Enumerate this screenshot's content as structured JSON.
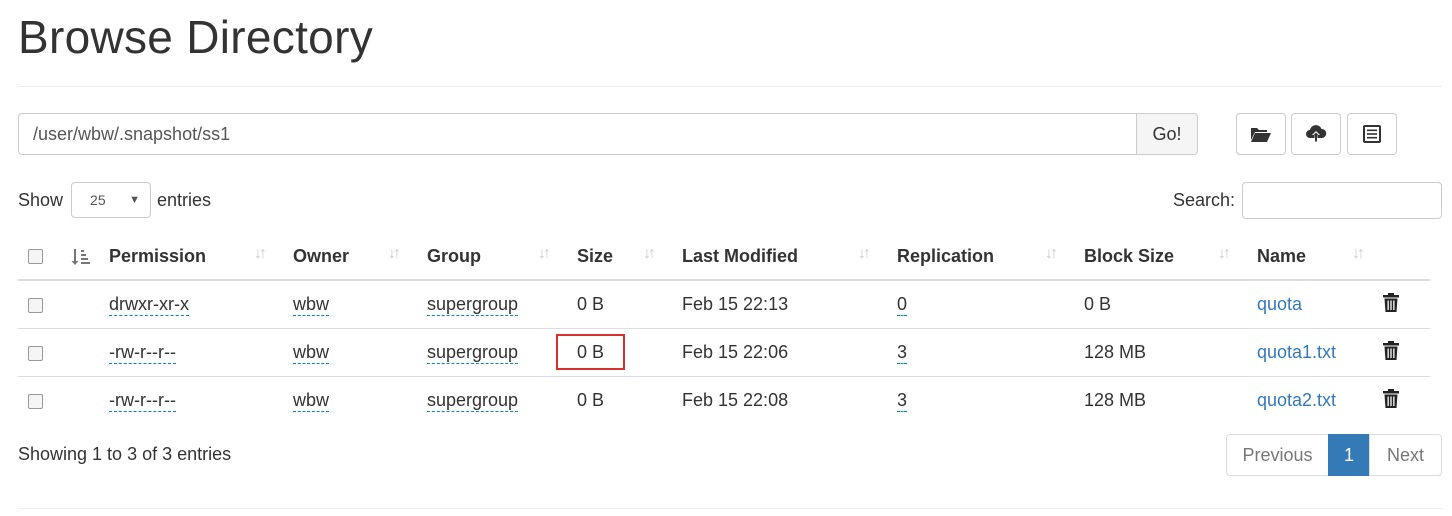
{
  "header": {
    "title": "Browse Directory"
  },
  "path_bar": {
    "value": "/user/wbw/.snapshot/ss1",
    "go_label": "Go!"
  },
  "toolbar_icons": [
    "open-folder-icon",
    "cloud-upload-icon",
    "list-icon"
  ],
  "length_control": {
    "show_label": "Show",
    "selected": "25",
    "entries_label": "entries"
  },
  "search": {
    "label": "Search:",
    "value": ""
  },
  "table": {
    "columns": [
      "Permission",
      "Owner",
      "Group",
      "Size",
      "Last Modified",
      "Replication",
      "Block Size",
      "Name"
    ],
    "rows": [
      {
        "permission": "drwxr-xr-x",
        "owner": "wbw",
        "group": "supergroup",
        "size": "0 B",
        "modified": "Feb 15 22:13",
        "replication": "0",
        "block_size": "0 B",
        "name": "quota"
      },
      {
        "permission": "-rw-r--r--",
        "owner": "wbw",
        "group": "supergroup",
        "size": "0 B",
        "modified": "Feb 15 22:06",
        "replication": "3",
        "block_size": "128 MB",
        "name": "quota1.txt"
      },
      {
        "permission": "-rw-r--r--",
        "owner": "wbw",
        "group": "supergroup",
        "size": "0 B",
        "modified": "Feb 15 22:08",
        "replication": "3",
        "block_size": "128 MB",
        "name": "quota2.txt"
      }
    ]
  },
  "footer": {
    "info": "Showing 1 to 3 of 3 entries"
  },
  "pagination": {
    "previous": "Previous",
    "current": "1",
    "next": "Next"
  },
  "colors": {
    "link": "#337ab7",
    "highlight": "#d9302c",
    "active_page": "#337ab7"
  }
}
